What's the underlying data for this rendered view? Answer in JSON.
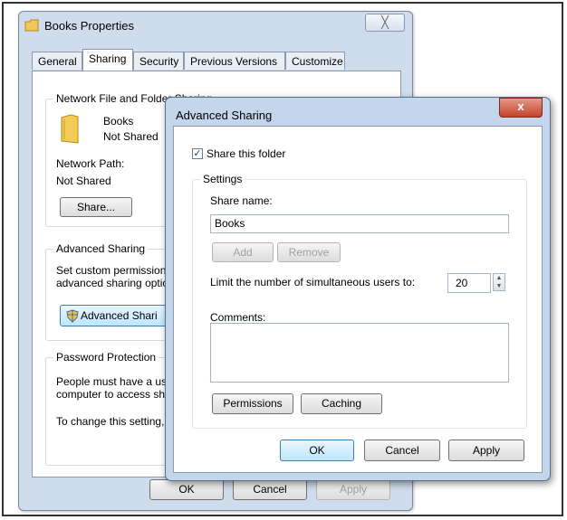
{
  "props": {
    "title": "Books Properties",
    "close_label": "╳",
    "tabs": [
      "General",
      "Sharing",
      "Security",
      "Previous Versions",
      "Customize"
    ],
    "network_sharing": {
      "heading": "Network File and Folder Sharing",
      "folder_name": "Books",
      "folder_status": "Not Shared",
      "path_label": "Network Path:",
      "path_value": "Not Shared",
      "share_button": "Share..."
    },
    "advanced_sharing": {
      "heading": "Advanced Sharing",
      "desc_line1": "Set custom permissions",
      "desc_line2": "advanced sharing optic",
      "button": "Advanced Shari"
    },
    "password": {
      "heading": "Password Protection",
      "line1": "People must have a us",
      "line2": "computer to access sh",
      "line3": "To change this setting,"
    },
    "footer": {
      "ok": "OK",
      "cancel": "Cancel",
      "apply": "Apply"
    }
  },
  "adv": {
    "title": "Advanced Sharing",
    "close_label": "x",
    "share_checkbox_label": "Share this folder",
    "share_checked": true,
    "settings_heading": "Settings",
    "share_name_label": "Share name:",
    "share_name_value": "Books",
    "add_button": "Add",
    "remove_button": "Remove",
    "limit_label": "Limit the number of simultaneous users to:",
    "limit_value": "20",
    "comments_label": "Comments:",
    "comments_value": "",
    "permissions_button": "Permissions",
    "caching_button": "Caching",
    "ok": "OK",
    "cancel": "Cancel",
    "apply": "Apply"
  },
  "colors": {
    "dialog_frame": "#c4d6ec",
    "close_red": "#c4432b",
    "default_button": "#3c7fb1"
  },
  "icons": [
    "folder-icon",
    "shield-icon",
    "checkmark-icon",
    "spin-up-icon",
    "spin-down-icon"
  ]
}
